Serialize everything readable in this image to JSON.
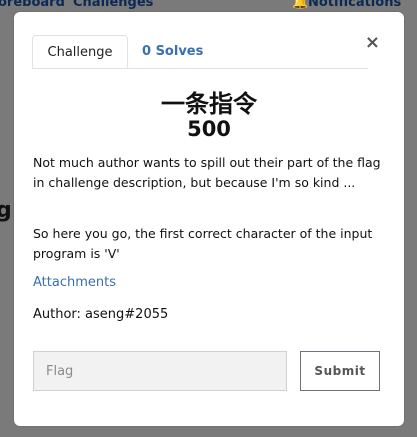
{
  "background": {
    "nav_left": "oreboard",
    "nav_challenges": "Challenges",
    "nav_notifications": "Notifications",
    "side_char": "g"
  },
  "modal": {
    "close_label": "×",
    "tabs": [
      {
        "label": "Challenge",
        "active": true
      },
      {
        "label": "0 Solves",
        "active": false
      }
    ],
    "challenge_name": "一条指令",
    "points": "500",
    "description": [
      "Not much author wants to spill out their part of the flag in challenge description, but because I'm so kind ...",
      "So here you go, the first correct character of the input program is 'V'"
    ],
    "attachments_label": "Attachments",
    "author": "Author: aseng#2055",
    "flag_placeholder": "Flag",
    "submit_label": "Submit"
  },
  "colors": {
    "overlay": "#7a7a7a",
    "link": "#3a6fb0",
    "modal_bg": "#ffffff"
  },
  "icons": [
    "close-icon",
    "bell-icon"
  ]
}
